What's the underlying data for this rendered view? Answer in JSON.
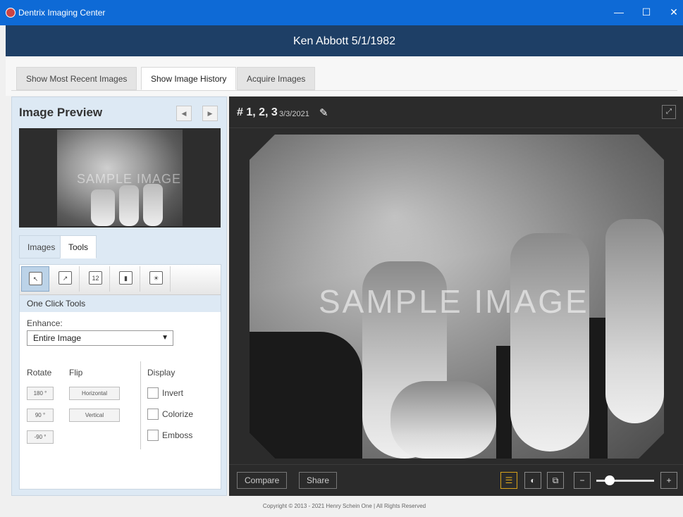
{
  "window": {
    "title": "Dentrix Imaging Center",
    "minimize": "—",
    "maximize": "☐",
    "close": "✕"
  },
  "patient": {
    "header": "Ken Abbott 5/1/1982"
  },
  "top_tabs": [
    {
      "label": "Show Most Recent Images",
      "active": false
    },
    {
      "label": "Show Image History",
      "active": true
    },
    {
      "label": "Acquire Images",
      "active": false
    }
  ],
  "preview": {
    "title": "Image Preview",
    "prev": "◀",
    "next": "▶",
    "watermark": "SAMPLE IMAGE"
  },
  "sub_tabs": [
    {
      "label": "Images",
      "active": false
    },
    {
      "label": "Tools",
      "active": true
    }
  ],
  "tool_icons": [
    "one-click-tools-icon",
    "measure-icon",
    "calibrate-icon",
    "histogram-icon",
    "brightness-icon"
  ],
  "tools": {
    "section": "One Click Tools",
    "enhance_label": "Enhance:",
    "enhance_value": "Entire Image",
    "rotate_label": "Rotate",
    "flip_label": "Flip",
    "display_label": "Display",
    "rotate_buttons": [
      "180 °",
      "90 °",
      "-90 °"
    ],
    "flip_buttons": [
      "Horizontal",
      "Vertical"
    ],
    "display_options": [
      "Invert",
      "Colorize",
      "Emboss"
    ]
  },
  "viewer": {
    "tooth_label": "# 1, 2, 3",
    "date": "3/3/2021",
    "watermark": "SAMPLE IMAGE",
    "compare": "Compare",
    "share": "Share",
    "zoom_out": "−",
    "zoom_in": "+",
    "zoom_level": 0.3
  },
  "footer": {
    "copyright": "Copyright © 2013 - 2021 Henry Schein One | All Rights Reserved"
  },
  "colors": {
    "titlebar": "#0e6ad6",
    "header": "#1e3f66",
    "accent": "#d7a21b",
    "panel": "#dde9f4"
  }
}
